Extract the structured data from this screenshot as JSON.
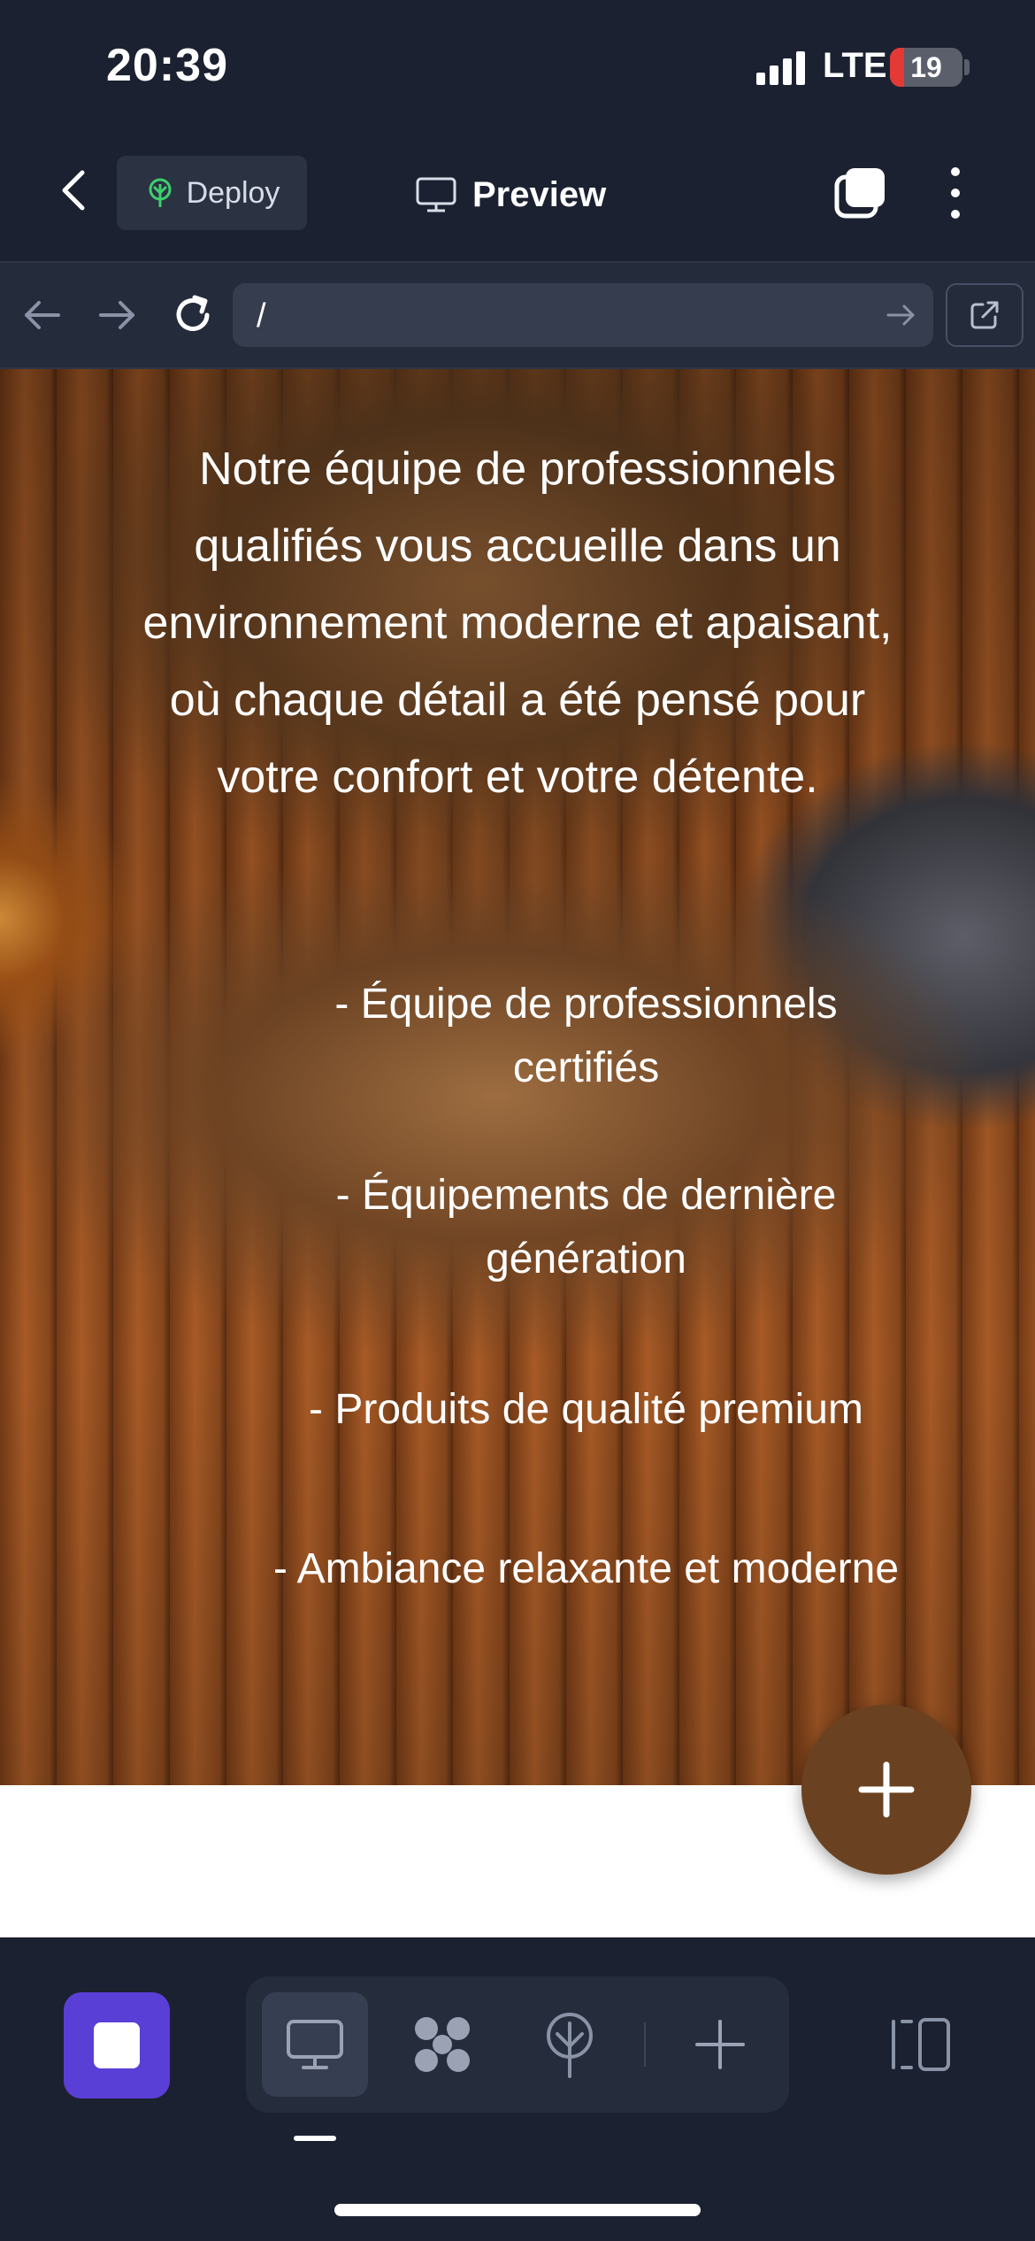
{
  "status_bar": {
    "time": "20:39",
    "network": "LTE",
    "battery_level": "19",
    "battery_fraction": 0.19,
    "signal_icon": "signal-bars-icon"
  },
  "header": {
    "back_icon": "chevron-left-icon",
    "deploy_label": "Deploy",
    "deploy_icon": "deploy-tree-icon",
    "preview_label": "Preview",
    "preview_icon": "monitor-icon",
    "tabs_icon": "tabs-stack-icon",
    "more_icon": "vertical-dots-icon"
  },
  "browser": {
    "back_icon": "arrow-left-icon",
    "forward_icon": "arrow-right-icon",
    "reload_icon": "reload-icon",
    "url": "/",
    "go_icon": "arrow-right-icon",
    "open_external_icon": "external-link-icon"
  },
  "content": {
    "intro": "Notre équipe de professionnels qualifiés vous accueille dans un environnement moderne et apaisant, où chaque détail a été pensé pour votre confort et votre détente.",
    "features": [
      "- Équipe de professionnels certifiés",
      "- Équipements de dernière génération",
      "- Produits de qualité premium",
      "- Ambiance relaxante et moderne"
    ],
    "fab_icon": "plus-icon"
  },
  "toolbar": {
    "stop_icon": "stop-square-icon",
    "tools": [
      "monitor-icon",
      "grid-blob-icon",
      "deploy-tree-icon",
      "plus-icon"
    ],
    "panel_icon": "side-panel-icon"
  },
  "colors": {
    "background": "#1b2130",
    "accent": "#5a3fd6",
    "fab": "#6b4221",
    "battery_low": "#e53935",
    "deploy_icon": "#3ecf6e"
  }
}
